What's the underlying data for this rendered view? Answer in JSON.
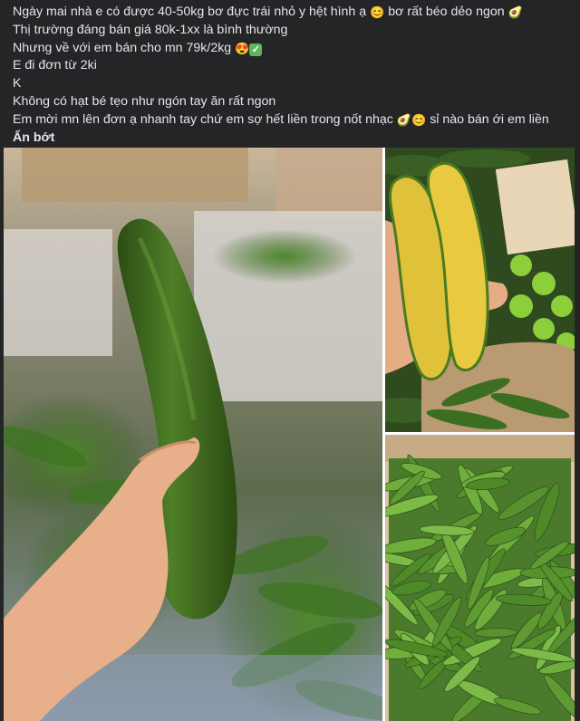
{
  "post": {
    "lines": [
      "Ngày mai nhà e có được 40-50kg bơ đực trái nhỏ y hệt hình ạ",
      "bơ rất béo dẻo ngon",
      "Thị trường đáng bán giá 80k-1xx là bình thường",
      "Nhưng về với em bán cho mn 79k/2kg",
      "E đi đơn từ 2ki",
      "K",
      "Không có hạt bé tẹo như ngón tay ăn rất ngon",
      "Em mời mn lên đơn ạ nhanh tay chứ em sợ hết liền trong nốt nhạc",
      "sỉ nào bán ới em liền"
    ],
    "see_more": "Ẩn bớt",
    "emojis": [
      "smiling-face-emoji",
      "avocado-emoji",
      "heart-eyes-emoji",
      "check-mark-emoji"
    ]
  },
  "photos": [
    {
      "name": "photo-hand-holding-avocado"
    },
    {
      "name": "photo-cut-avocado-halves"
    },
    {
      "name": "photo-box-of-avocados"
    }
  ],
  "colors": {
    "background": "#242526",
    "text": "#e4e6eb",
    "avocado_skin": "#3f6b1f",
    "avocado_flesh": "#e3c23a"
  }
}
